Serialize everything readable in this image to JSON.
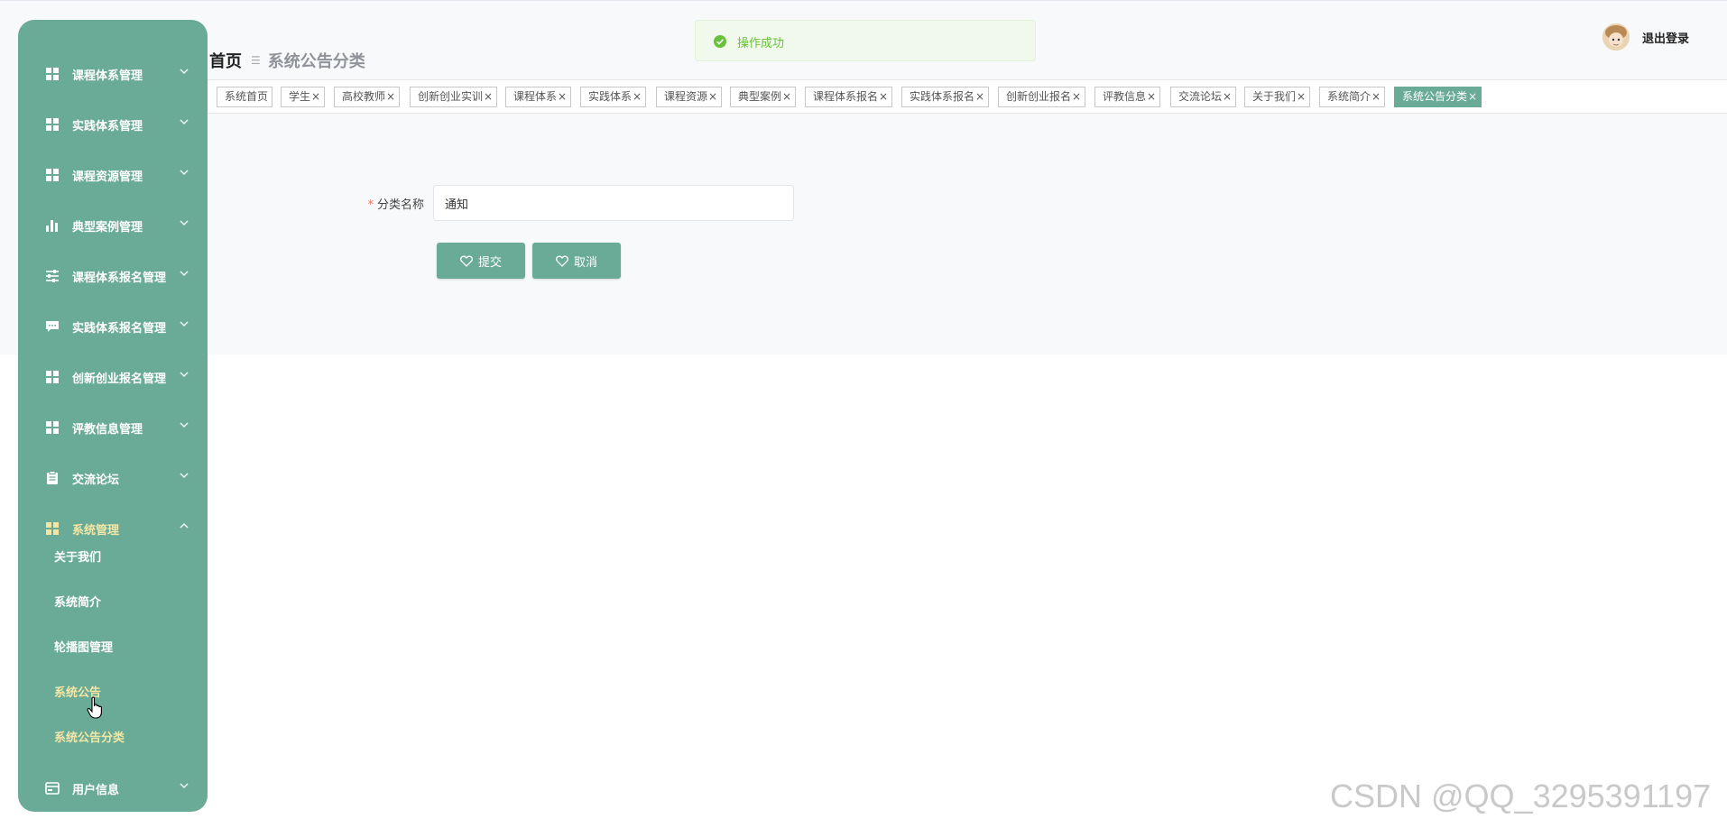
{
  "sidebar": {
    "items": [
      {
        "label": "课程体系管理",
        "icon": "grid-icon"
      },
      {
        "label": "实践体系管理",
        "icon": "grid-icon"
      },
      {
        "label": "课程资源管理",
        "icon": "grid-icon"
      },
      {
        "label": "典型案例管理",
        "icon": "bar-chart-icon"
      },
      {
        "label": "课程体系报名管理",
        "icon": "sliders-icon"
      },
      {
        "label": "实践体系报名管理",
        "icon": "chat-icon"
      },
      {
        "label": "创新创业报名管理",
        "icon": "grid-icon"
      },
      {
        "label": "评教信息管理",
        "icon": "grid-icon"
      },
      {
        "label": "交流论坛",
        "icon": "clipboard-icon"
      },
      {
        "label": "系统管理",
        "icon": "grid-icon",
        "expanded": true
      },
      {
        "label": "用户信息",
        "icon": "card-icon"
      }
    ],
    "submenu": [
      "关于我们",
      "系统简介",
      "轮播图管理",
      "系统公告",
      "系统公告分类"
    ]
  },
  "header": {
    "breadcrumb_home": "首页",
    "breadcrumb_current": "系统公告分类",
    "logout": "退出登录"
  },
  "toast": {
    "message": "操作成功"
  },
  "tabs": [
    {
      "label": "系统首页",
      "closable": false
    },
    {
      "label": "学生",
      "closable": true
    },
    {
      "label": "高校教师",
      "closable": true
    },
    {
      "label": "创新创业实训",
      "closable": true
    },
    {
      "label": "课程体系",
      "closable": true
    },
    {
      "label": "实践体系",
      "closable": true
    },
    {
      "label": "课程资源",
      "closable": true
    },
    {
      "label": "典型案例",
      "closable": true
    },
    {
      "label": "课程体系报名",
      "closable": true
    },
    {
      "label": "实践体系报名",
      "closable": true
    },
    {
      "label": "创新创业报名",
      "closable": true
    },
    {
      "label": "评教信息",
      "closable": true
    },
    {
      "label": "交流论坛",
      "closable": true
    },
    {
      "label": "关于我们",
      "closable": true
    },
    {
      "label": "系统简介",
      "closable": true
    },
    {
      "label": "系统公告分类",
      "closable": true,
      "active": true
    }
  ],
  "form": {
    "required_mark": "*",
    "category_label": "分类名称",
    "category_value": "通知",
    "submit_label": "提交",
    "cancel_label": "取消"
  },
  "watermark": "CSDN @QQ_3295391197",
  "colors": {
    "primary": "#6aab97",
    "highlight": "#f3e6a5",
    "success": "#67c23a"
  }
}
